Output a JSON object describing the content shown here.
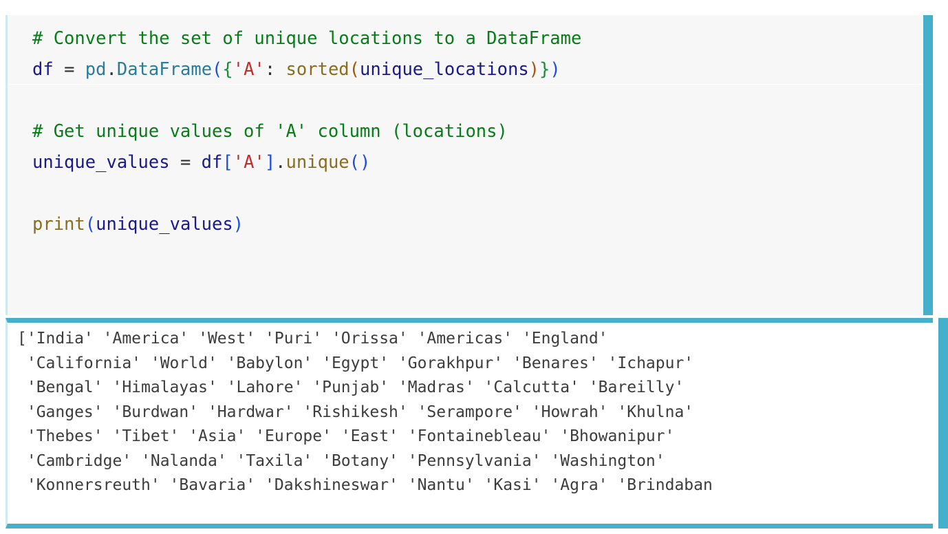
{
  "theme": {
    "page_background": "#ffffff",
    "code_background": "#f7f7f7",
    "output_background": "#ffffff",
    "accent_teal": "#45b0cc",
    "left_strip": "#cfe9f0",
    "comment_color": "#067d17",
    "name_color": "#1a1a8c",
    "module_color": "#2b7c98",
    "builtin_color": "#8a6d1e",
    "string_color": "#c42b2b",
    "bracket_blue": "#1a4de0",
    "bracket_green": "#1f8a3b",
    "bracket_brown": "#a8520a",
    "output_text_color": "#3c3c3c"
  },
  "code_cell": {
    "lines": [
      {
        "id": "line-1",
        "tokens": [
          {
            "text": "# Convert the set of unique locations to a DataFrame",
            "cls": "t-comment"
          }
        ]
      },
      {
        "id": "line-2",
        "tokens": [
          {
            "text": "df",
            "cls": "t-name"
          },
          {
            "text": " ",
            "cls": "t-op"
          },
          {
            "text": "=",
            "cls": "t-op"
          },
          {
            "text": " ",
            "cls": "t-op"
          },
          {
            "text": "pd",
            "cls": "t-module"
          },
          {
            "text": ".",
            "cls": "t-dot"
          },
          {
            "text": "DataFrame",
            "cls": "t-module"
          },
          {
            "text": "(",
            "cls": "t-br-blue"
          },
          {
            "text": "{",
            "cls": "t-br-green"
          },
          {
            "text": "'A'",
            "cls": "t-string"
          },
          {
            "text": ":",
            "cls": "t-punct"
          },
          {
            "text": " ",
            "cls": "t-op"
          },
          {
            "text": "sorted",
            "cls": "t-builtin"
          },
          {
            "text": "(",
            "cls": "t-br-brown"
          },
          {
            "text": "unique_locations",
            "cls": "t-name"
          },
          {
            "text": ")",
            "cls": "t-br-brown"
          },
          {
            "text": "}",
            "cls": "t-br-green"
          },
          {
            "text": ")",
            "cls": "t-br-blue"
          }
        ]
      },
      {
        "id": "line-3",
        "tokens": []
      },
      {
        "id": "line-4",
        "tokens": [
          {
            "text": "# Get unique values of 'A' column (locations)",
            "cls": "t-comment"
          }
        ]
      },
      {
        "id": "line-5",
        "tokens": [
          {
            "text": "unique_values",
            "cls": "t-name"
          },
          {
            "text": " ",
            "cls": "t-op"
          },
          {
            "text": "=",
            "cls": "t-op"
          },
          {
            "text": " ",
            "cls": "t-op"
          },
          {
            "text": "df",
            "cls": "t-name"
          },
          {
            "text": "[",
            "cls": "t-br-blue"
          },
          {
            "text": "'A'",
            "cls": "t-string"
          },
          {
            "text": "]",
            "cls": "t-br-blue"
          },
          {
            "text": ".",
            "cls": "t-dot"
          },
          {
            "text": "unique",
            "cls": "t-method"
          },
          {
            "text": "(",
            "cls": "t-br-blue"
          },
          {
            "text": ")",
            "cls": "t-br-blue"
          }
        ]
      },
      {
        "id": "line-6",
        "tokens": []
      },
      {
        "id": "line-7",
        "tokens": [
          {
            "text": "print",
            "cls": "t-builtin"
          },
          {
            "text": "(",
            "cls": "t-br-blue"
          },
          {
            "text": "unique_values",
            "cls": "t-name"
          },
          {
            "text": ")",
            "cls": "t-br-blue"
          }
        ]
      }
    ]
  },
  "output_cell": {
    "lines": [
      "['India' 'America' 'West' 'Puri' 'Orissa' 'Americas' 'England'",
      " 'California' 'World' 'Babylon' 'Egypt' 'Gorakhpur' 'Benares' 'Ichapur'",
      " 'Bengal' 'Himalayas' 'Lahore' 'Punjab' 'Madras' 'Calcutta' 'Bareilly'",
      " 'Ganges' 'Burdwan' 'Hardwar' 'Rishikesh' 'Serampore' 'Howrah' 'Khulna'",
      " 'Thebes' 'Tibet' 'Asia' 'Europe' 'East' 'Fontainebleau' 'Bhowanipur'",
      " 'Cambridge' 'Nalanda' 'Taxila' 'Botany' 'Pennsylvania' 'Washington'",
      " 'Konnersreuth' 'Bavaria' 'Dakshineswar' 'Nantu' 'Kasi' 'Agra' 'Brindaban"
    ],
    "values": [
      "India",
      "America",
      "West",
      "Puri",
      "Orissa",
      "Americas",
      "England",
      "California",
      "World",
      "Babylon",
      "Egypt",
      "Gorakhpur",
      "Benares",
      "Ichapur",
      "Bengal",
      "Himalayas",
      "Lahore",
      "Punjab",
      "Madras",
      "Calcutta",
      "Bareilly",
      "Ganges",
      "Burdwan",
      "Hardwar",
      "Rishikesh",
      "Serampore",
      "Howrah",
      "Khulna",
      "Thebes",
      "Tibet",
      "Asia",
      "Europe",
      "East",
      "Fontainebleau",
      "Bhowanipur",
      "Cambridge",
      "Nalanda",
      "Taxila",
      "Botany",
      "Pennsylvania",
      "Washington",
      "Konnersreuth",
      "Bavaria",
      "Dakshineswar",
      "Nantu",
      "Kasi",
      "Agra",
      "Brindaban"
    ]
  }
}
